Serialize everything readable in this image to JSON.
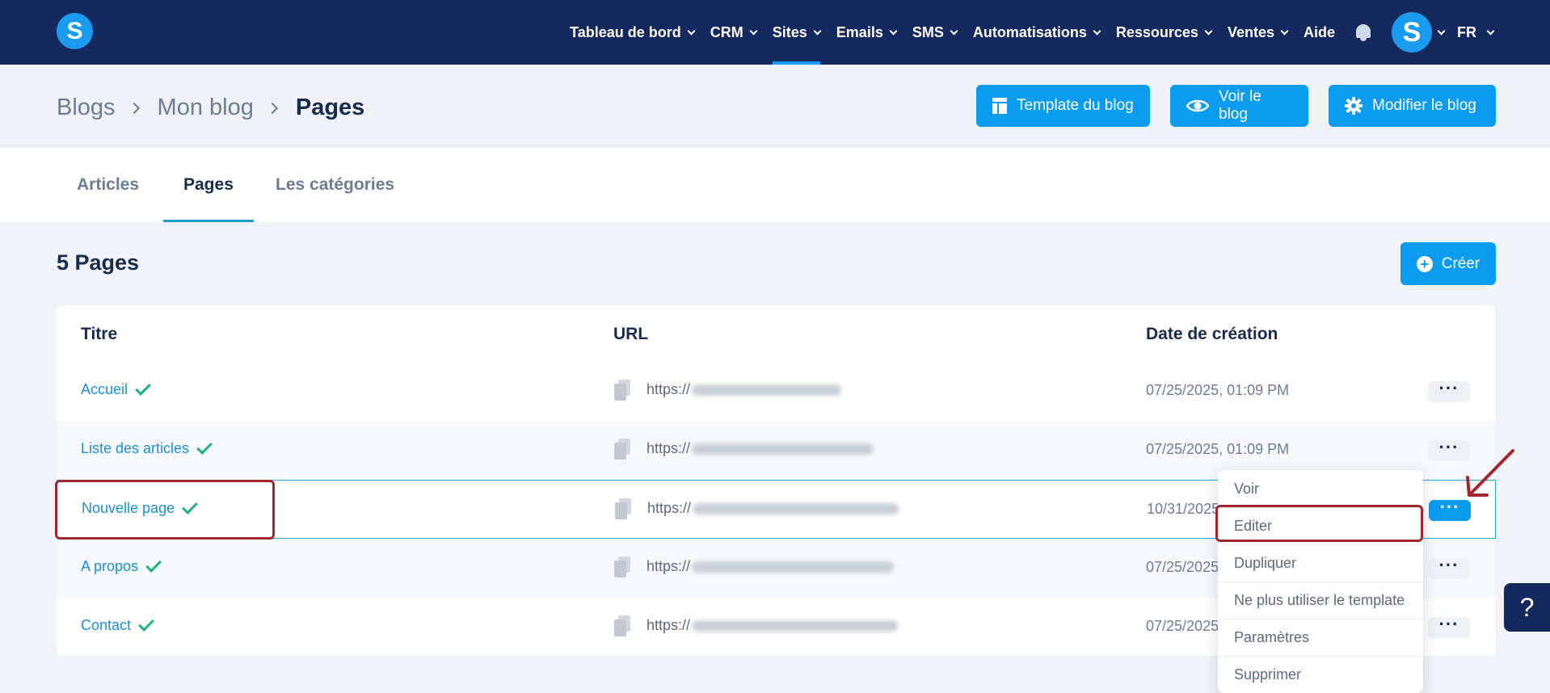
{
  "nav": {
    "items": [
      {
        "label": "Tableau de bord",
        "dropdown": true
      },
      {
        "label": "CRM",
        "dropdown": true
      },
      {
        "label": "Sites",
        "dropdown": true,
        "active": true
      },
      {
        "label": "Emails",
        "dropdown": true
      },
      {
        "label": "SMS",
        "dropdown": true
      },
      {
        "label": "Automatisations",
        "dropdown": true
      },
      {
        "label": "Ressources",
        "dropdown": true
      },
      {
        "label": "Ventes",
        "dropdown": true
      },
      {
        "label": "Aide",
        "dropdown": false
      }
    ],
    "logo_letter": "S",
    "avatar_letter": "S",
    "language": "FR"
  },
  "breadcrumb": [
    "Blogs",
    "Mon blog",
    "Pages"
  ],
  "header_buttons": {
    "template": "Template du blog",
    "view": "Voir le blog",
    "edit": "Modifier le blog"
  },
  "tabs": [
    "Articles",
    "Pages",
    "Les catégories"
  ],
  "active_tab": "Pages",
  "count_title": "5 Pages",
  "create_label": "Créer",
  "table": {
    "headers": {
      "title": "Titre",
      "url": "URL",
      "date": "Date de création"
    },
    "rows": [
      {
        "title": "Accueil",
        "url_prefix": "https://",
        "date": "07/25/2025, 01:09 PM"
      },
      {
        "title": "Liste des articles",
        "url_prefix": "https://",
        "date": "07/25/2025, 01:09 PM"
      },
      {
        "title": "Nouvelle page",
        "url_prefix": "https://",
        "date": "10/31/2025"
      },
      {
        "title": "A propos",
        "url_prefix": "https://",
        "date": "07/25/2025"
      },
      {
        "title": "Contact",
        "url_prefix": "https://",
        "date": "07/25/2025"
      }
    ]
  },
  "menu": {
    "items": [
      "Voir",
      "Editer",
      "Dupliquer",
      "Ne plus utiliser le template",
      "Paramètres",
      "Supprimer"
    ]
  },
  "help_label": "?",
  "colors": {
    "topbar": "#142a5e",
    "accent": "#0b9bef",
    "annotation": "#a3262e",
    "check": "#1db47a",
    "link": "#1a8fd8"
  }
}
